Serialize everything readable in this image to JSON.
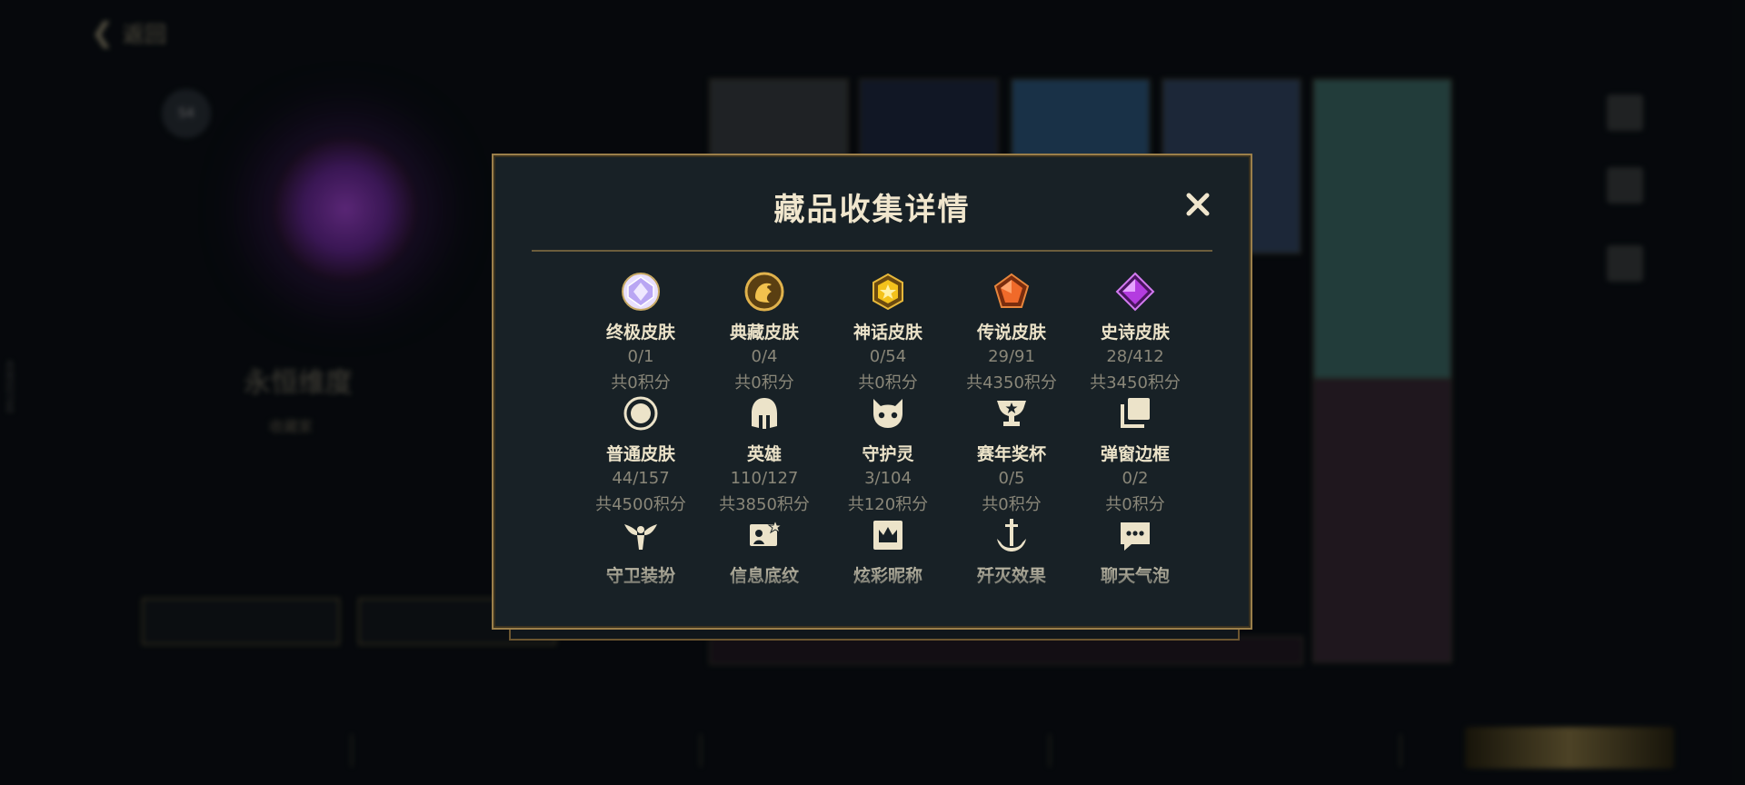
{
  "background": {
    "back_label": "返回",
    "badge_text": "S4",
    "player_name": "永恒维度",
    "player_sub": "收藏家",
    "buttons": [
      "",
      ""
    ],
    "tabs": [
      "",
      "",
      "",
      "",
      ""
    ],
    "bottom_button": "",
    "side_id": "40B5D7A8"
  },
  "modal": {
    "title": "藏品收集详情",
    "close_icon": "close-icon",
    "items": [
      {
        "icon": "ultimate-skin-gem-icon",
        "label": "终极皮肤",
        "count": "0/1",
        "points": "共0积分"
      },
      {
        "icon": "prestige-skin-dragon-icon",
        "label": "典藏皮肤",
        "count": "0/4",
        "points": "共0积分"
      },
      {
        "icon": "mythic-skin-gem-icon",
        "label": "神话皮肤",
        "count": "0/54",
        "points": "共0积分"
      },
      {
        "icon": "legendary-skin-gem-icon",
        "label": "传说皮肤",
        "count": "29/91",
        "points": "共4350积分"
      },
      {
        "icon": "epic-skin-gem-icon",
        "label": "史诗皮肤",
        "count": "28/412",
        "points": "共3450积分"
      },
      {
        "icon": "regular-skin-circle-icon",
        "label": "普通皮肤",
        "count": "44/157",
        "points": "共4500积分"
      },
      {
        "icon": "champion-helmet-icon",
        "label": "英雄",
        "count": "110/127",
        "points": "共3850积分"
      },
      {
        "icon": "little-legend-face-icon",
        "label": "守护灵",
        "count": "3/104",
        "points": "共120积分"
      },
      {
        "icon": "season-trophy-icon",
        "label": "赛年奖杯",
        "count": "0/5",
        "points": "共0积分"
      },
      {
        "icon": "popup-frame-stack-icon",
        "label": "弹窗边框",
        "count": "0/2",
        "points": "共0积分"
      },
      {
        "icon": "guardian-wings-icon",
        "label": "守卫装扮",
        "count": "",
        "points": ""
      },
      {
        "icon": "profile-pattern-icon",
        "label": "信息底纹",
        "count": "",
        "points": ""
      },
      {
        "icon": "crown-nickname-icon",
        "label": "炫彩昵称",
        "count": "",
        "points": ""
      },
      {
        "icon": "anchor-effect-icon",
        "label": "歼灭效果",
        "count": "",
        "points": ""
      },
      {
        "icon": "chat-bubble-icon",
        "label": "聊天气泡",
        "count": "",
        "points": ""
      }
    ]
  },
  "colors": {
    "gold_border": "#9b7f4a",
    "title": "#f0e6cd",
    "muted": "#8a8779",
    "modal_bg": "#182126"
  }
}
